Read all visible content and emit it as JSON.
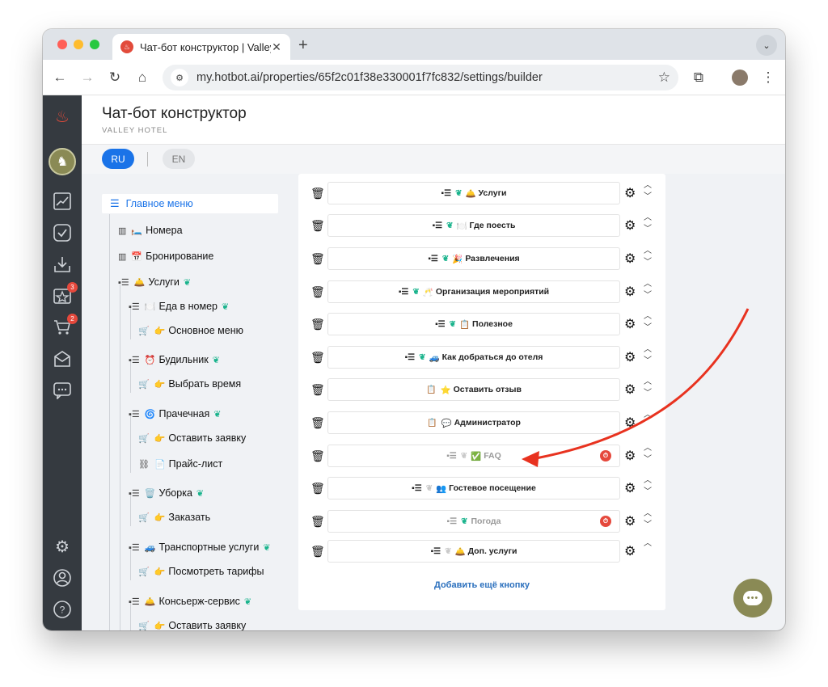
{
  "browser": {
    "tab_title": "Чат-бот конструктор | Valley",
    "url": "my.hotbot.ai/properties/65f2c01f38e330001f7fc832/settings/builder"
  },
  "nav_badges": {
    "reviews": "3",
    "cart": "2"
  },
  "header": {
    "title": "Чат-бот конструктор",
    "subtitle": "VALLEY HOTEL"
  },
  "languages": {
    "active": "RU",
    "other": "EN"
  },
  "tree": {
    "main_menu": "Главное меню",
    "nodes": [
      {
        "icon": "bar-chart-icon",
        "emoji": "🛏️",
        "label": "Номера",
        "brain": false
      },
      {
        "icon": "bar-chart-icon",
        "emoji": "📅",
        "label": "Бронирование",
        "brain": false
      },
      {
        "icon": "card-icon",
        "emoji": "🛎️",
        "label": "Услуги",
        "brain": true
      },
      {
        "icon": "card-icon",
        "emoji": "🍽️",
        "label": "Еда в номер",
        "brain": true
      },
      {
        "icon": "cart-icon",
        "emoji": "👉",
        "label": "Основное меню",
        "brain": false
      },
      {
        "icon": "card-icon",
        "emoji": "⏰",
        "label": "Будильник",
        "brain": true
      },
      {
        "icon": "cart-icon",
        "emoji": "👉",
        "label": "Выбрать время",
        "brain": false
      },
      {
        "icon": "card-icon",
        "emoji": "🌀",
        "label": "Прачечная",
        "brain": true
      },
      {
        "icon": "cart-icon",
        "emoji": "👉",
        "label": "Оставить заявку",
        "brain": false
      },
      {
        "icon": "link-icon",
        "emoji": "📄",
        "label": "Прайс-лист",
        "brain": false
      },
      {
        "icon": "card-icon",
        "emoji": "🗑️",
        "label": "Уборка",
        "brain": true
      },
      {
        "icon": "cart-icon",
        "emoji": "👉",
        "label": "Заказать",
        "brain": false
      },
      {
        "icon": "card-icon",
        "emoji": "🚙",
        "label": "Транспортные услуги",
        "brain": true
      },
      {
        "icon": "cart-icon",
        "emoji": "👉",
        "label": "Посмотреть тарифы",
        "brain": false
      },
      {
        "icon": "card-icon",
        "emoji": "🛎️",
        "label": "Консьерж-сервис",
        "brain": true
      },
      {
        "icon": "cart-icon",
        "emoji": "👉",
        "label": "Оставить заявку",
        "brain": false
      }
    ]
  },
  "buttons": [
    {
      "type": "card",
      "brain": "green",
      "emoji": "🛎️",
      "label": "Услуги",
      "dim": false,
      "timer": false,
      "arrows": "both"
    },
    {
      "type": "card",
      "brain": "green",
      "emoji": "🍽️",
      "label": "Где поесть",
      "dim": false,
      "timer": false,
      "arrows": "both"
    },
    {
      "type": "card",
      "brain": "green",
      "emoji": "🎉",
      "label": "Развлечения",
      "dim": false,
      "timer": false,
      "arrows": "both"
    },
    {
      "type": "card",
      "brain": "green",
      "emoji": "🥂",
      "label": "Организация мероприятий",
      "dim": false,
      "timer": false,
      "arrows": "both"
    },
    {
      "type": "card",
      "brain": "green",
      "emoji": "📋",
      "label": "Полезное",
      "dim": false,
      "timer": false,
      "arrows": "both"
    },
    {
      "type": "card",
      "brain": "green",
      "emoji": "🚙",
      "label": "Как добраться до отеля",
      "dim": false,
      "timer": false,
      "arrows": "both"
    },
    {
      "type": "clipboard",
      "brain": "none",
      "emoji": "⭐",
      "label": "Оставить отзыв",
      "dim": false,
      "timer": false,
      "arrows": "both"
    },
    {
      "type": "clipboard",
      "brain": "none",
      "emoji": "💬",
      "label": "Администратор",
      "dim": false,
      "timer": false,
      "arrows": "up"
    },
    {
      "type": "card",
      "brain": "gray",
      "emoji": "✅",
      "label": "FAQ",
      "dim": true,
      "timer": true,
      "arrows": "both"
    },
    {
      "type": "card",
      "brain": "gray",
      "emoji": "👥",
      "label": "Гостевое посещение",
      "dim": false,
      "timer": false,
      "arrows": "both"
    },
    {
      "type": "card",
      "brain": "green",
      "emoji": "",
      "label": "Погода",
      "dim": true,
      "timer": true,
      "arrows": "both"
    },
    {
      "type": "card",
      "brain": "gray",
      "emoji": "🛎️",
      "label": "Доп. услуги",
      "dim": false,
      "timer": false,
      "arrows": "up"
    }
  ],
  "add_button": "Добавить ещё кнопку",
  "colors": {
    "accent": "#1a73e8",
    "brain": "#19b38c",
    "sidebar": "#353a40",
    "annotation_arrow": "#e8321f",
    "chat": "#8a8a55"
  }
}
